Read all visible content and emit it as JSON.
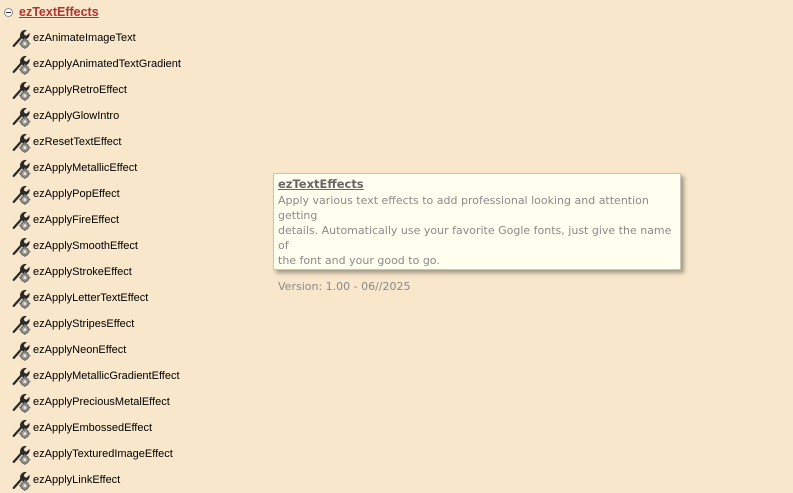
{
  "tree": {
    "root_label": "ezTextEffects",
    "items": [
      {
        "label": "ezAnimateImageText",
        "icon": "wrench-gear-icon"
      },
      {
        "label": "ezApplyAnimatedTextGradient",
        "icon": "wrench-gear-icon"
      },
      {
        "label": "ezApplyRetroEffect",
        "icon": "wrench-gear-icon"
      },
      {
        "label": "ezApplyGlowIntro",
        "icon": "wrench-gear-icon"
      },
      {
        "label": "ezResetTextEffect",
        "icon": "wrench-gear-icon"
      },
      {
        "label": "ezApplyMetallicEffect",
        "icon": "wrench-gear-icon"
      },
      {
        "label": "ezApplyPopEffect",
        "icon": "wrench-gear-icon"
      },
      {
        "label": "ezApplyFireEffect",
        "icon": "wrench-gear-icon"
      },
      {
        "label": "ezApplySmoothEffect",
        "icon": "wrench-gear-icon"
      },
      {
        "label": "ezApplyStrokeEffect",
        "icon": "wrench-gear-icon"
      },
      {
        "label": "ezApplyLetterTextEffect",
        "icon": "wrench-gear-icon"
      },
      {
        "label": "ezApplyStripesEffect",
        "icon": "wrench-gear-icon"
      },
      {
        "label": "ezApplyNeonEffect",
        "icon": "wrench-gear-icon"
      },
      {
        "label": "ezApplyMetallicGradientEffect",
        "icon": "wrench-gear-icon"
      },
      {
        "label": "ezApplyPreciousMetalEffect",
        "icon": "wrench-gear-icon"
      },
      {
        "label": "ezApplyEmbossedEffect",
        "icon": "wrench-gear-icon"
      },
      {
        "label": "ezApplyTexturedImageEffect",
        "icon": "wrench-gear-icon"
      },
      {
        "label": "ezApplyLinkEffect",
        "icon": "wrench-gear-icon"
      }
    ]
  },
  "tooltip": {
    "title": "ezTextEffects",
    "description_lines": [
      "Apply various text effects to add professional looking and attention getting",
      "details. Automatically use your favorite Gogle fonts, just give the name of",
      "the font and your good to go."
    ],
    "version": "Version: 1.00 - 06//2025"
  },
  "colors": {
    "background": "#f8e7cb",
    "root_label": "#b0332f",
    "tooltip_background": "#fffff0",
    "tooltip_text": "#8a8a8a"
  }
}
